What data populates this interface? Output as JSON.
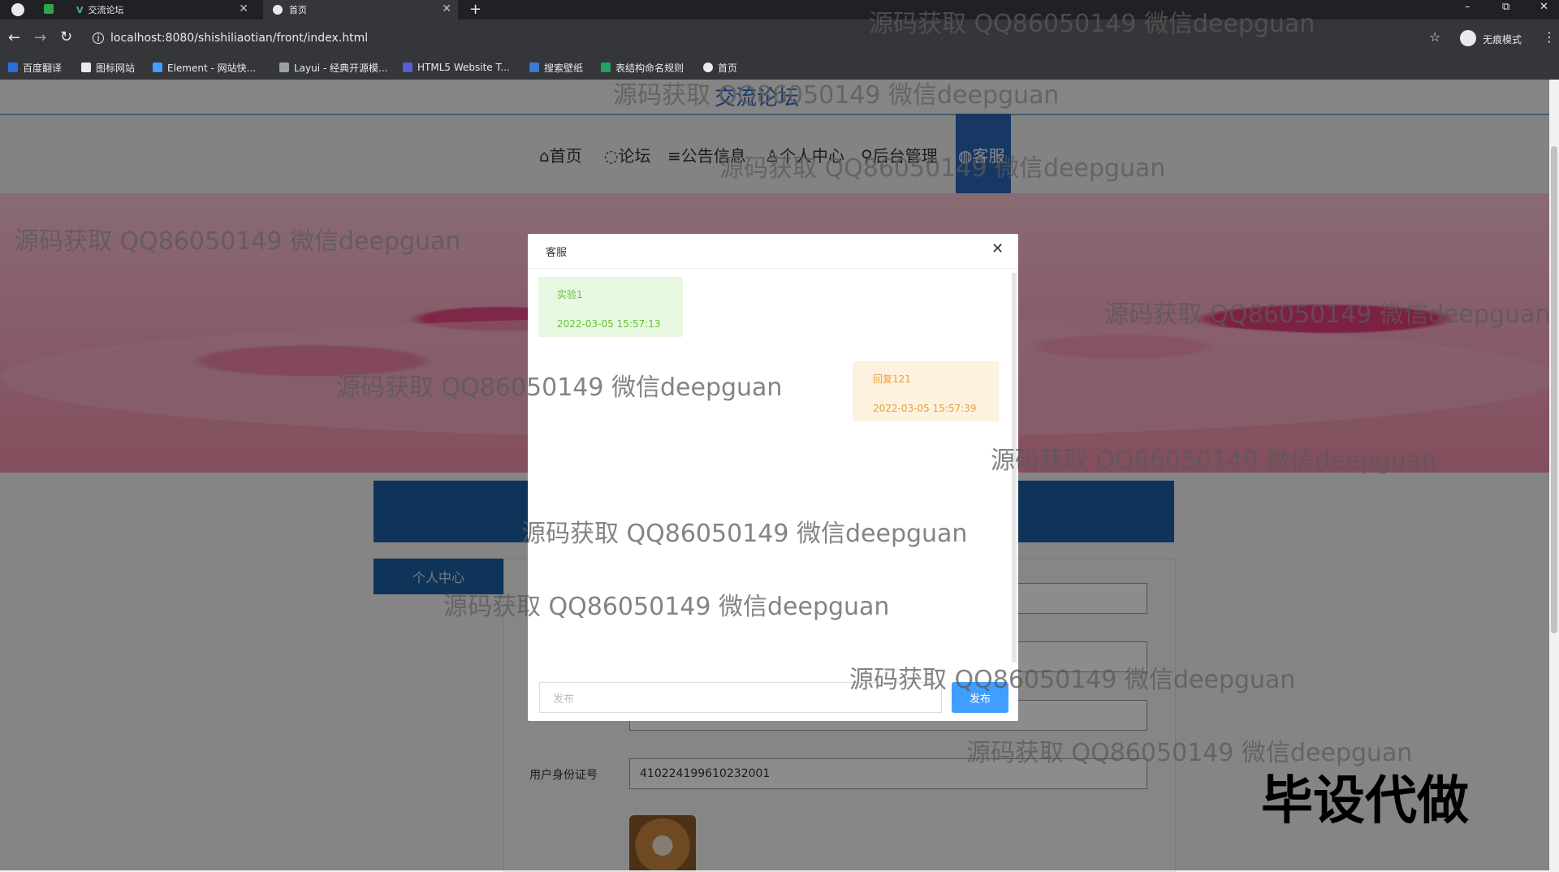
{
  "browser": {
    "tabs": [
      {
        "label": "交流论坛",
        "active": false
      },
      {
        "label": "首页",
        "active": true
      }
    ],
    "new_tab": "+",
    "window_controls": [
      "–",
      "⧉",
      "✕"
    ],
    "url": "localhost:8080/shishiliaotian/front/index.html",
    "profile_label": "无痕模式",
    "bookmarks": [
      "百度翻译",
      "图标网站",
      "Element - 网站快...",
      "Layui - 经典开源模...",
      "HTML5 Website T...",
      "搜索壁纸",
      "表结构命名规则",
      "首页"
    ]
  },
  "site": {
    "title": "交流论坛",
    "nav": [
      {
        "label": "首页",
        "icon": "home-icon"
      },
      {
        "label": "论坛",
        "icon": "forum-icon"
      },
      {
        "label": "公告信息",
        "icon": "list-icon"
      },
      {
        "label": "个人中心",
        "icon": "user-icon"
      },
      {
        "label": "后台管理",
        "icon": "link-icon"
      },
      {
        "label": "客服",
        "icon": "service-icon",
        "active": true
      }
    ]
  },
  "personal": {
    "side_label": "个人中心",
    "id_label": "用户身份证号",
    "id_value": "410224199610232001"
  },
  "dialog": {
    "title": "客服",
    "close": "✕",
    "messages": [
      {
        "side": "left",
        "text": "实验1",
        "time": "2022-03-05 15:57:13"
      },
      {
        "side": "right",
        "text": "回复121",
        "time": "2022-03-05 15:57:39"
      }
    ],
    "input_placeholder": "发布",
    "send_label": "发布"
  },
  "colors": {
    "accent": "#2b66b8",
    "send": "#409eff",
    "left_bubble": "#e8f7e0",
    "right_bubble": "#fdf1df"
  },
  "watermark": "源码获取 QQ86050149 微信deepguan",
  "corner_text": "毕设代做"
}
